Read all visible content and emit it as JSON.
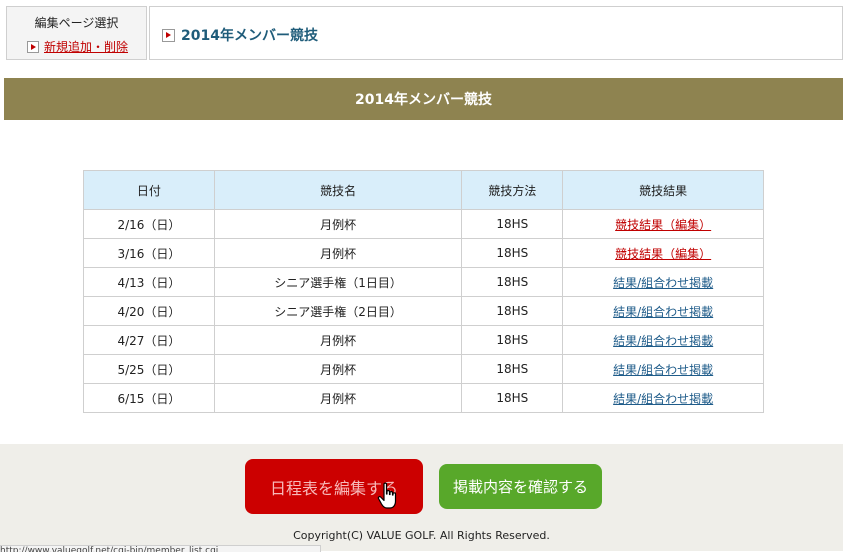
{
  "sidebar": {
    "title": "編集ページ選択",
    "add_delete_link": "新規追加・削除"
  },
  "current_page": {
    "title": "2014年メンバー競技"
  },
  "banner": {
    "title": "2014年メンバー競技"
  },
  "schedule": {
    "headers": [
      "日付",
      "競技名",
      "競技方法",
      "競技結果"
    ],
    "rows": [
      {
        "date": "2/16（日）",
        "name": "月例杯",
        "method": "18HS",
        "result": "競技結果（編集）",
        "result_style": "red"
      },
      {
        "date": "3/16（日）",
        "name": "月例杯",
        "method": "18HS",
        "result": "競技結果（編集）",
        "result_style": "red"
      },
      {
        "date": "4/13（日）",
        "name": "シニア選手権（1日目）",
        "method": "18HS",
        "result": "結果/組合わせ掲載",
        "result_style": "blue"
      },
      {
        "date": "4/20（日）",
        "name": "シニア選手権（2日目）",
        "method": "18HS",
        "result": "結果/組合わせ掲載",
        "result_style": "blue"
      },
      {
        "date": "4/27（日）",
        "name": "月例杯",
        "method": "18HS",
        "result": "結果/組合わせ掲載",
        "result_style": "blue"
      },
      {
        "date": "5/25（日）",
        "name": "月例杯",
        "method": "18HS",
        "result": "結果/組合わせ掲載",
        "result_style": "blue"
      },
      {
        "date": "6/15（日）",
        "name": "月例杯",
        "method": "18HS",
        "result": "結果/組合わせ掲載",
        "result_style": "blue"
      }
    ]
  },
  "footer": {
    "edit_button": "日程表を編集する",
    "confirm_button": "掲載内容を確認する",
    "copyright": "Copyright(C) VALUE GOLF. All Rights Reserved."
  },
  "status_bar": {
    "text": "http://www.valuegolf.net/cgi-bin/member_list.cgi"
  },
  "colors": {
    "banner": "#8e8350",
    "header_cell": "#d9eefa",
    "edit_button": "#cc0000",
    "confirm_button": "#58a82a",
    "link_red": "#c00000",
    "link_blue": "#1f5c8a"
  },
  "icons": [
    "marker-arrow-icon",
    "hand-cursor-icon"
  ]
}
